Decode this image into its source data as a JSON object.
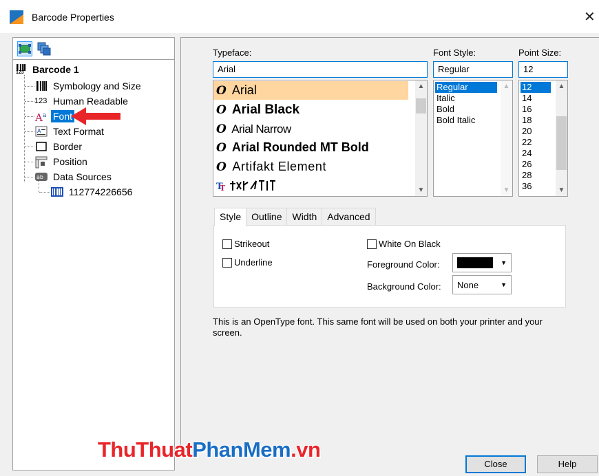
{
  "window": {
    "title": "Barcode Properties",
    "close_glyph": "✕"
  },
  "tree": {
    "root": "Barcode 1",
    "items": [
      {
        "label": "Symbology and Size",
        "icon": "barcode-icon"
      },
      {
        "label": "Human Readable",
        "icon": "number-123-icon"
      },
      {
        "label": "Font",
        "icon": "font-icon"
      },
      {
        "label": "Text Format",
        "icon": "text-format-icon"
      },
      {
        "label": "Border",
        "icon": "border-icon"
      },
      {
        "label": "Position",
        "icon": "position-icon"
      },
      {
        "label": "Data Sources",
        "icon": "data-sources-icon"
      }
    ],
    "data_source": "112774226656",
    "root_icon_text": "123",
    "human_readable_prefix": "123"
  },
  "typeface": {
    "label": "Typeface:",
    "value": "Arial",
    "options": [
      "Arial",
      "Arial Black",
      "Arial Narrow",
      "Arial Rounded MT Bold",
      "Artifakt Element"
    ],
    "selected": "Arial"
  },
  "font_style": {
    "label": "Font Style:",
    "value": "Regular",
    "options": [
      "Regular",
      "Italic",
      "Bold",
      "Bold Italic"
    ],
    "selected": "Regular"
  },
  "point_size": {
    "label": "Point Size:",
    "value": "12",
    "options": [
      "12",
      "14",
      "16",
      "18",
      "20",
      "22",
      "24",
      "26",
      "28",
      "36"
    ],
    "selected": "12"
  },
  "tabs": [
    "Style",
    "Outline",
    "Width",
    "Advanced"
  ],
  "active_tab": "Style",
  "style_tab": {
    "strikeout": "Strikeout",
    "underline": "Underline",
    "white_on_black": "White On Black",
    "foreground_label": "Foreground Color:",
    "foreground_color": "#000000",
    "background_label": "Background Color:",
    "background_value": "None"
  },
  "description": "This is an OpenType font. This same font will be used on both your printer and your screen.",
  "buttons": {
    "close": "Close",
    "help": "Help"
  },
  "watermark": {
    "part1": "ThuThuat",
    "part2": "PhanMem",
    "part3": ".vn"
  },
  "colors": {
    "selection": "#0078d7",
    "typeface_highlight": "#ffd6a0",
    "arrow": "#e8262a"
  }
}
